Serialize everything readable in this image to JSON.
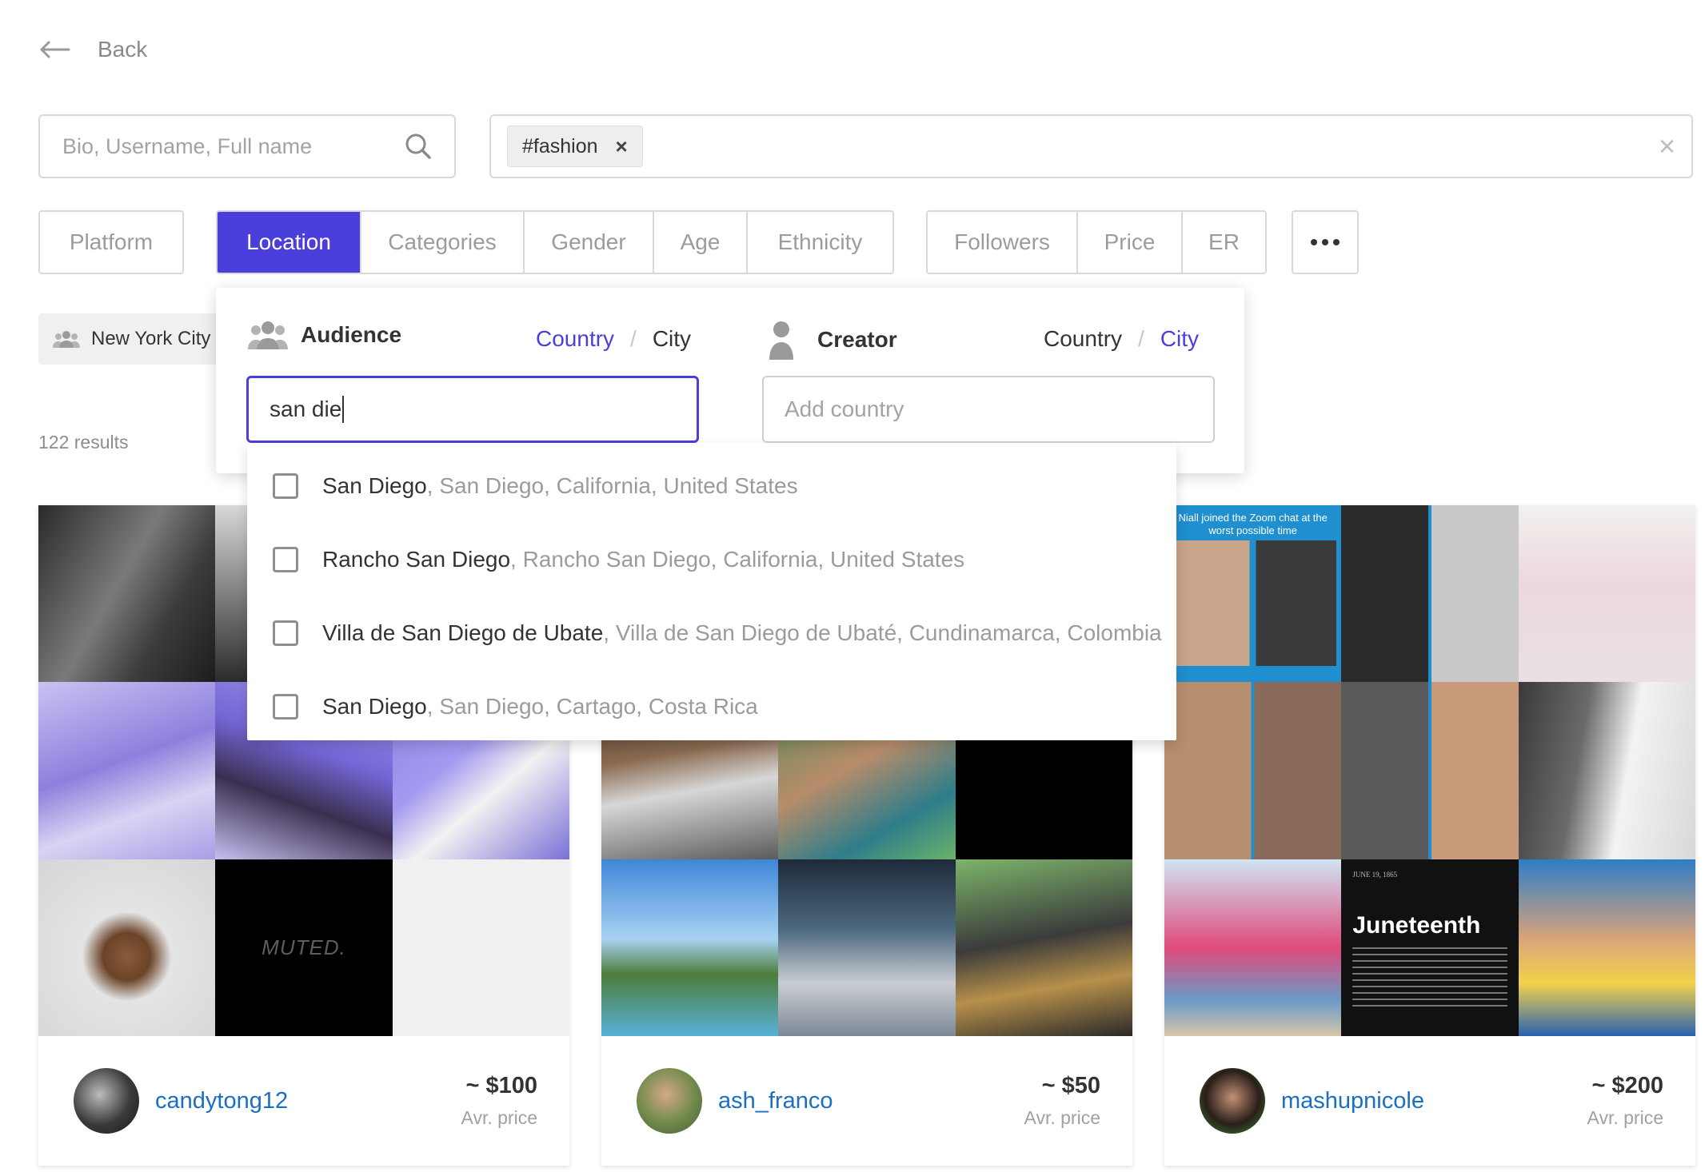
{
  "back": {
    "label": "Back"
  },
  "search": {
    "placeholder": "Bio, Username, Full name",
    "value": ""
  },
  "tags": {
    "items": [
      "#fashion"
    ]
  },
  "filters": {
    "group1": [
      "Platform"
    ],
    "group2": [
      "Location",
      "Categories",
      "Gender",
      "Age",
      "Ethnicity"
    ],
    "group3": [
      "Followers",
      "Price",
      "ER"
    ],
    "active": "Location"
  },
  "applied_chip": {
    "label": "New York City"
  },
  "results": {
    "count_text": "122 results"
  },
  "location_panel": {
    "audience": {
      "title": "Audience",
      "opt_country": "Country",
      "opt_city": "City",
      "selected": "Country",
      "input_value": "san die"
    },
    "creator": {
      "title": "Creator",
      "opt_country": "Country",
      "opt_city": "City",
      "selected": "City",
      "input_placeholder": "Add country"
    },
    "suggestions": [
      {
        "main": "San Diego",
        "sub": ", San Diego, California, United States",
        "checked": false
      },
      {
        "main": "Rancho San Diego",
        "sub": ", Rancho San Diego, California, United States",
        "checked": false
      },
      {
        "main": "Villa de San Diego de Ubate",
        "sub": ", Villa de San Diego de Ubaté, Cundinamarca, Colombia",
        "checked": false
      },
      {
        "main": "San Diego",
        "sub": ", San Diego, Cartago, Costa Rica",
        "checked": false
      }
    ]
  },
  "cards": [
    {
      "username": "candytong12",
      "price": "~ $100",
      "price_label": "Avr. price",
      "muted_text": "MUTED."
    },
    {
      "username": "ash_franco",
      "price": "~ $50",
      "price_label": "Avr. price"
    },
    {
      "username": "mashupnicole",
      "price": "~ $200",
      "price_label": "Avr. price",
      "post_caption": "Niall joined the Zoom chat at the worst possible time",
      "juneteenth_title": "Juneteenth",
      "juneteenth_date": "JUNE 19, 1865"
    }
  ],
  "colors": {
    "accent": "#4b3fdb",
    "link": "#1a6fc4",
    "border": "#d9d9d9"
  },
  "icons": {
    "back": "arrow-left-icon",
    "search": "search-icon",
    "remove_tag": "close-icon",
    "clear": "close-icon",
    "more": "ellipsis-icon",
    "audience": "users-icon",
    "creator": "user-icon"
  }
}
